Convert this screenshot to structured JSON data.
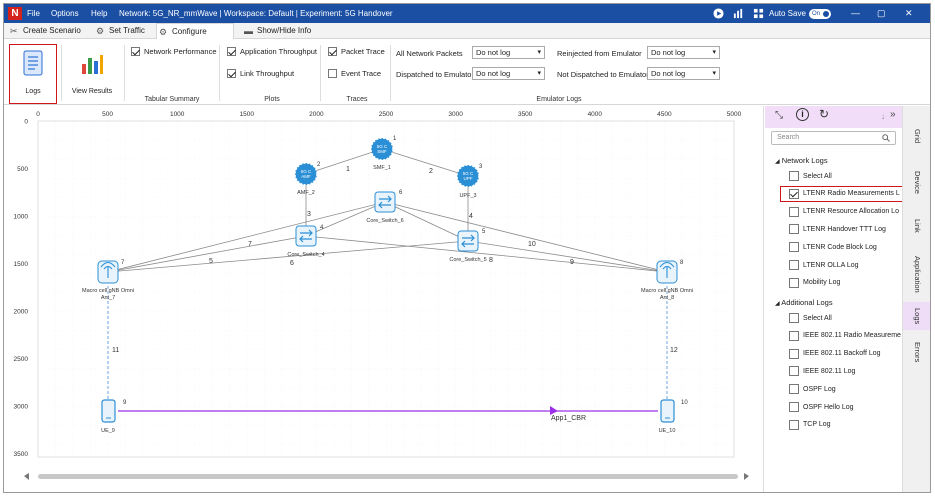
{
  "titlebar": {
    "menus": [
      "File",
      "Options",
      "Help"
    ],
    "title": "Network: 5G_NR_mmWave | Workspace: Default | Experiment: 5G Handover",
    "autosave_label": "Auto Save",
    "autosave_state": "On",
    "window_controls": [
      "—",
      "▢",
      "✕"
    ]
  },
  "tabs": [
    {
      "label": "Create Scenario",
      "icon": "create-scenario-icon"
    },
    {
      "label": "Set Traffic",
      "icon": "set-traffic-icon"
    },
    {
      "label": "Configure Reports",
      "icon": "configure-reports-icon",
      "active": true
    },
    {
      "label": "Show/Hide Info",
      "icon": "show-hide-info-icon"
    }
  ],
  "ribbon": {
    "logs_label": "Logs",
    "view_results_label": "View Results",
    "tabular_summary": {
      "network_performance": "Network Performance",
      "group": "Tabular Summary"
    },
    "plots": {
      "app_throughput": "Application Throughput",
      "link_throughput": "Link Throughput",
      "group": "Plots"
    },
    "traces": {
      "packet_trace": "Packet Trace",
      "event_trace": "Event Trace",
      "group": "Traces"
    },
    "emulator": {
      "all_network_packets": "All Network Packets",
      "dispatched": "Dispatched to Emulator",
      "reinjected": "Reinjected from Emulator",
      "not_dispatched": "Not Dispatched to Emulator",
      "option": "Do not log",
      "group": "Emulator Logs"
    }
  },
  "canvas": {
    "x_ticks": [
      "0",
      "500",
      "1000",
      "1500",
      "2000",
      "2500",
      "3000",
      "3500",
      "4000",
      "4500",
      "5000"
    ],
    "y_ticks": [
      "0",
      "500",
      "1000",
      "1500",
      "2000",
      "2500",
      "3000",
      "3500"
    ],
    "nodes": {
      "smf": {
        "label": "SMF_1",
        "id": "1",
        "icon_text": "5G C\nSMF"
      },
      "amf": {
        "label": "AMF_2",
        "id": "2",
        "icon_text": "5G C\nAMF"
      },
      "upf": {
        "label": "UPF_3",
        "id": "3",
        "icon_text": "5G C\nUPF"
      },
      "cs6": {
        "label": "Core_Switch_6",
        "id": "6"
      },
      "cs4": {
        "label": "Core_Switch_4",
        "id": "4"
      },
      "cs5": {
        "label": "Core_Switch_5",
        "id": "5"
      },
      "gnb7": {
        "label1": "Macro cell gNB Omni",
        "label2": "Ant_7",
        "id": "7"
      },
      "gnb8": {
        "label1": "Macro cell gNB Omni",
        "label2": "Ant_8",
        "id": "8"
      },
      "ue9": {
        "label": "UE_9",
        "id": "9"
      },
      "ue10": {
        "label": "UE_10",
        "id": "10"
      }
    },
    "link_labels": [
      "1",
      "2",
      "3",
      "4",
      "5",
      "6",
      "7",
      "8",
      "9",
      "10",
      "11",
      "12"
    ],
    "app_label": "App1_CBR"
  },
  "panel": {
    "search_placeholder": "Search",
    "network_logs_title": "Network Logs",
    "network_logs": [
      {
        "label": "Select All",
        "checked": false
      },
      {
        "label": "LTENR Radio Measurements L",
        "checked": true
      },
      {
        "label": "LTENR Resource Allocation Lo",
        "checked": false
      },
      {
        "label": "LTENR Handover TTT Log",
        "checked": false
      },
      {
        "label": "LTENR Code Block Log",
        "checked": false
      },
      {
        "label": "LTENR OLLA Log",
        "checked": false
      },
      {
        "label": "Mobility Log",
        "checked": false
      }
    ],
    "additional_logs_title": "Additional Logs",
    "additional_logs": [
      {
        "label": "Select All",
        "checked": false
      },
      {
        "label": "IEEE 802.11 Radio Measureme",
        "checked": false
      },
      {
        "label": "IEEE 802.11 Backoff Log",
        "checked": false
      },
      {
        "label": "IEEE 802.11 Log",
        "checked": false
      },
      {
        "label": "OSPF Log",
        "checked": false
      },
      {
        "label": "OSPF Hello Log",
        "checked": false
      },
      {
        "label": "TCP Log",
        "checked": false
      }
    ],
    "side_tabs": [
      "Grid",
      "Device",
      "Link",
      "Application",
      "Logs",
      "Errors"
    ]
  },
  "colors": {
    "titlebar": "#1b4fa3",
    "accent_red": "#d0151b",
    "link_app": "#9b30e8",
    "node_icon": "#2b8fd6"
  }
}
